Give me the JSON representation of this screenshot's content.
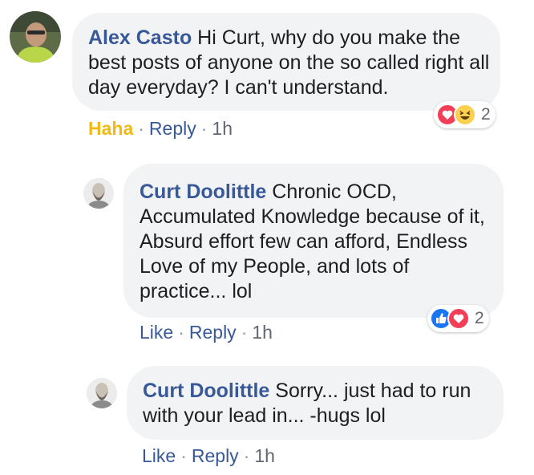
{
  "comments": [
    {
      "author": "Alex Casto",
      "text": "Hi Curt, why do you make the best posts of anyone on the so called right all day everyday? I can't understand.",
      "reaction": "Haha",
      "reply_label": "Reply",
      "time": "1h",
      "reaction_count": "2",
      "reaction_icons": [
        "love-icon",
        "haha-icon"
      ]
    },
    {
      "author": "Curt Doolittle",
      "text": "Chronic OCD, Accumulated Knowledge because of it, Absurd effort few can afford, Endless Love of my People, and lots of practice... lol",
      "like_label": "Like",
      "reply_label": "Reply",
      "time": "1h",
      "reaction_count": "2",
      "reaction_icons": [
        "like-icon",
        "love-icon"
      ]
    },
    {
      "author": "Curt Doolittle",
      "text": "Sorry... just had to run with your lead in... -hugs lol",
      "like_label": "Like",
      "reply_label": "Reply",
      "time": "1h"
    }
  ],
  "separator": "·",
  "colors": {
    "bubble": "#f2f3f5",
    "author": "#385898",
    "haha": "#f0ba15",
    "love": "#f33e58",
    "like": "#1877f2"
  }
}
